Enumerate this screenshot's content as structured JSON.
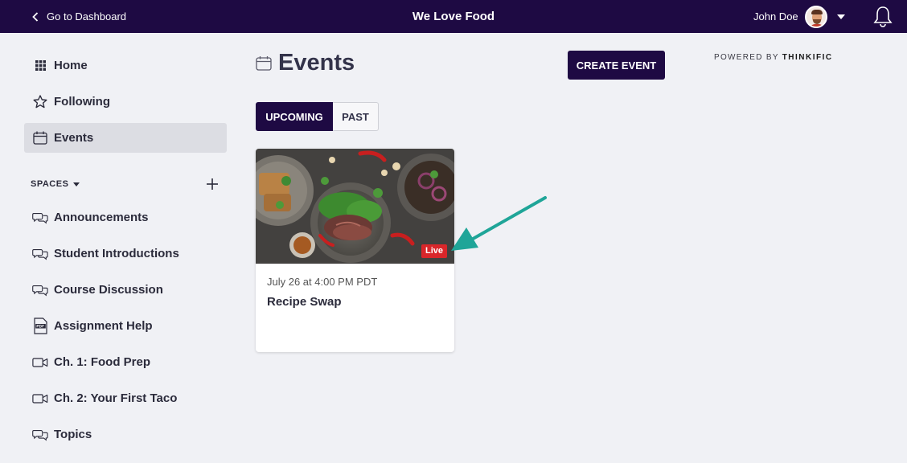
{
  "topbar": {
    "back_label": "Go to Dashboard",
    "site_title": "We Love Food",
    "user_name": "John Doe",
    "background_color": "#1e0a43"
  },
  "sidebar": {
    "items": [
      {
        "label": "Home",
        "icon": "grid-icon"
      },
      {
        "label": "Following",
        "icon": "star-icon"
      },
      {
        "label": "Events",
        "icon": "calendar-icon",
        "active": true
      }
    ],
    "spaces_label": "SPACES",
    "spaces": [
      {
        "label": "Announcements",
        "icon": "chat-bubbles-icon"
      },
      {
        "label": "Student Introductions",
        "icon": "chat-bubbles-icon"
      },
      {
        "label": "Course Discussion",
        "icon": "chat-bubbles-icon"
      },
      {
        "label": "Assignment Help",
        "icon": "pdf-icon"
      },
      {
        "label": "Ch. 1: Food Prep",
        "icon": "video-icon"
      },
      {
        "label": "Ch. 2: Your First Taco",
        "icon": "video-icon"
      },
      {
        "label": "Topics",
        "icon": "chat-bubbles-icon"
      }
    ]
  },
  "main": {
    "title": "Events",
    "create_button": "CREATE EVENT",
    "powered_prefix": "POWERED BY",
    "powered_brand": "THINKIFIC",
    "tabs": [
      {
        "label": "UPCOMING",
        "selected": true
      },
      {
        "label": "PAST",
        "selected": false
      }
    ],
    "events": [
      {
        "date": "July 26 at 4:00 PM PDT",
        "title": "Recipe Swap",
        "badge": "Live"
      }
    ]
  },
  "colors": {
    "accent": "#1e0a43",
    "live_badge": "#d9262a",
    "annotation_arrow": "#1fa598"
  }
}
